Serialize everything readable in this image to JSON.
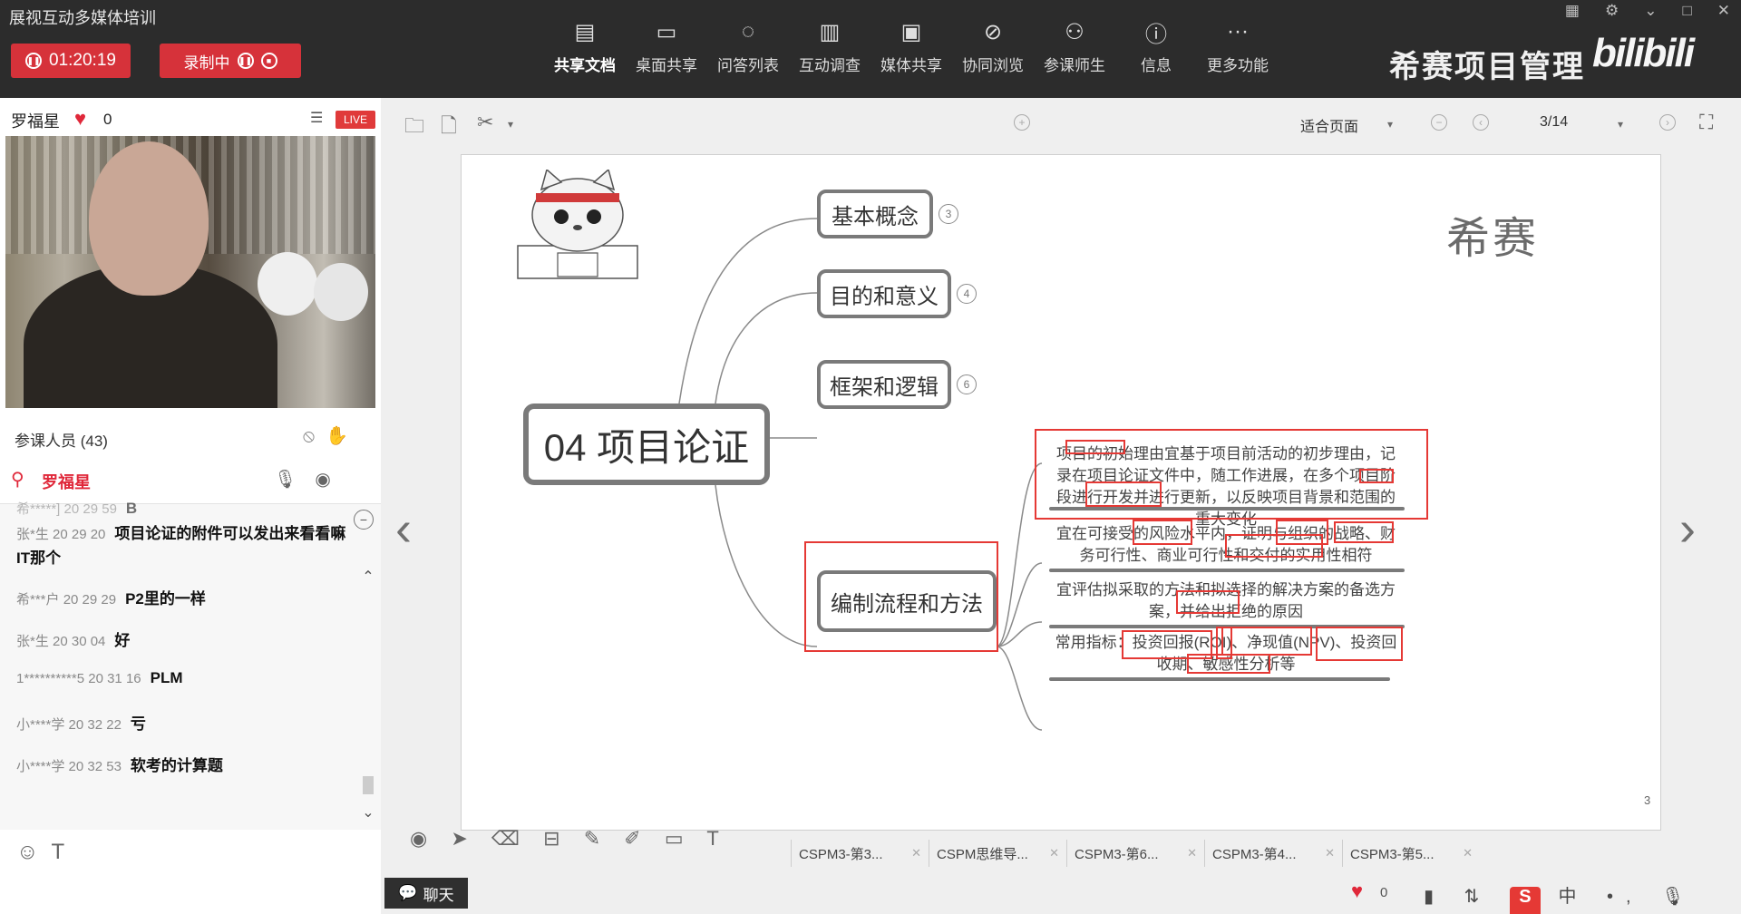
{
  "app": {
    "title": "展视互动多媒体培训"
  },
  "session": {
    "timer": "01:20:19",
    "record_label": "录制中"
  },
  "toolbar": {
    "items": [
      {
        "label": "共享文档",
        "icon": "document-icon"
      },
      {
        "label": "桌面共享",
        "icon": "desktop-share-icon"
      },
      {
        "label": "问答列表",
        "icon": "qa-icon"
      },
      {
        "label": "互动调查",
        "icon": "survey-icon"
      },
      {
        "label": "媒体共享",
        "icon": "media-icon"
      },
      {
        "label": "协同浏览",
        "icon": "compass-icon"
      },
      {
        "label": "参课师生",
        "icon": "people-icon"
      },
      {
        "label": "信息",
        "icon": "info-icon"
      },
      {
        "label": "更多功能",
        "icon": "more-icon"
      }
    ]
  },
  "brand": {
    "name": "希赛项目管理",
    "bili": "bilibili"
  },
  "host": {
    "name": "罗福星",
    "likes": "0",
    "live": "LIVE"
  },
  "participants": {
    "label": "参课人员 (43)"
  },
  "attendee": {
    "name": "罗福星"
  },
  "chat": {
    "messages": [
      {
        "user": "希*****]",
        "time": "20 29 59",
        "text": "B"
      },
      {
        "user": "张*生",
        "time": "20 29 20",
        "text": "项目论证的附件可以发出来看看嘛 IT那个"
      },
      {
        "user": "希***户",
        "time": "20 29 29",
        "text": "P2里的一样"
      },
      {
        "user": "张*生",
        "time": "20 30 04",
        "text": "好"
      },
      {
        "user": "1**********5",
        "time": "20 31 16",
        "text": "PLM"
      },
      {
        "user": "小****学",
        "time": "20 32 22",
        "text": "亏"
      },
      {
        "user": "小****学",
        "time": "20 32 53",
        "text": "软考的计算题"
      }
    ],
    "tab_label": "聊天"
  },
  "viewer": {
    "fit_label": "适合页面",
    "page": "3/14"
  },
  "slide": {
    "root": "04 项目论证",
    "branches": [
      {
        "label": "基本概念",
        "badge": "3"
      },
      {
        "label": "目的和意义",
        "badge": "4"
      },
      {
        "label": "框架和逻辑",
        "badge": "6"
      },
      {
        "label": "编制流程和方法",
        "badge": ""
      }
    ],
    "details": [
      "项目的初始理由宜基于项目前活动的初步理由，记录在项目论证文件中，随工作进展，在多个项目阶段进行开发并进行更新，以反映项目背景和范围的重大变化",
      "宜在可接受的风险水平内，证明与组织的战略、财务可行性、商业可行性和交付的实用性相符",
      "宜评估拟采取的方法和拟选择的解决方案的备选方案，并给出拒绝的原因",
      "常用指标：投资回报(ROI)、净现值(NPV)、投资回收期、敏感性分析等"
    ],
    "logo": "希赛",
    "page_number": "3"
  },
  "doc_tabs": [
    "CSPM3-第3...",
    "CSPM思维导...",
    "CSPM3-第6...",
    "CSPM3-第4...",
    "CSPM3-第5..."
  ],
  "status": {
    "likes": "0"
  },
  "colors": {
    "record_red": "#d6323a",
    "topbar": "#2c2c2c",
    "annotation_red": "#e53935"
  }
}
